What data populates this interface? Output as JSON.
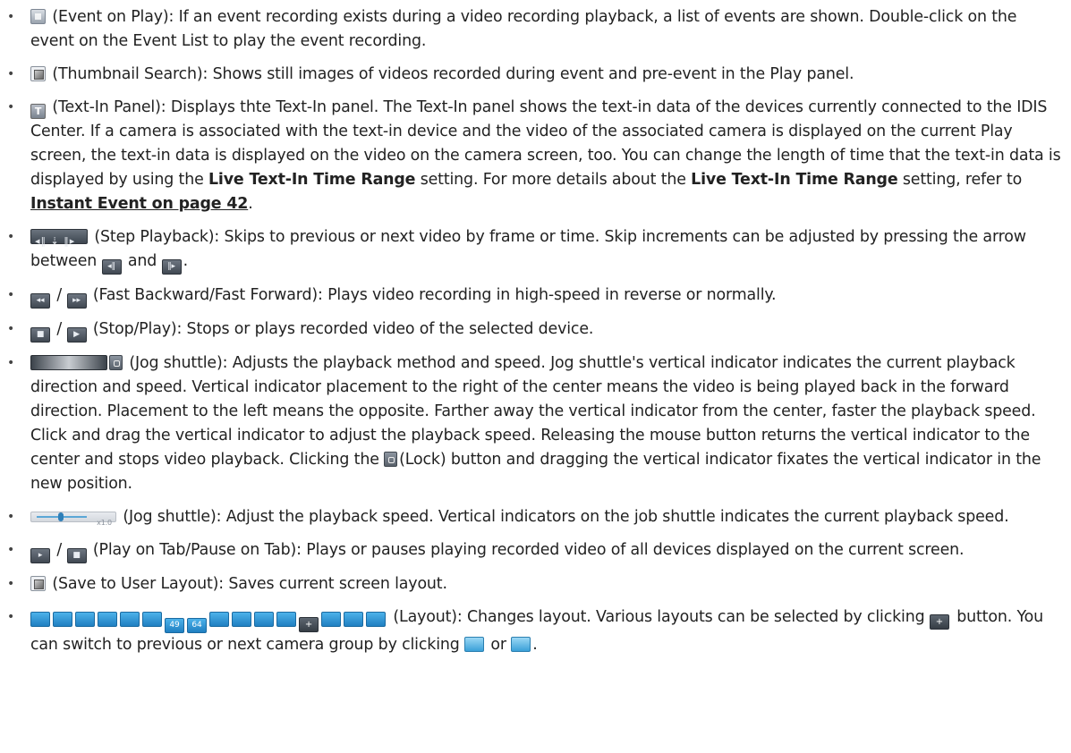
{
  "items": [
    {
      "icon_name": "event-on-play-icon",
      "text": "(Event on Play): If an event recording exists during a video recording playback, a list of events are shown. Double-click on the event on the Event List to play the event recording."
    },
    {
      "icon_name": "thumbnail-search-icon",
      "text": "(Thumbnail Search): Shows still images of videos recorded during event and pre-event in the Play panel."
    },
    {
      "icon_name": "text-in-panel-icon",
      "text_a": "(Text-In Panel): Displays thte Text-In panel. The Text-In panel shows the text-in data of the devices currently connected to the IDIS Center. If a camera is associated with the text-in device and the video of the associated camera is displayed on the current Play screen, the text-in data is displayed on the video on the camera screen, too. You can change the length of time that the text-in data is displayed by using the ",
      "bold_a": "Live Text-In Time Range",
      "text_b": " setting. For more details about the ",
      "bold_b": "Live Text-In Time Range",
      "text_c": " setting, refer to ",
      "link": "Instant Event on page 42",
      "text_d": "."
    },
    {
      "icon_name": "step-playback-icon",
      "text_a": "(Step Playback): Skips to previous or next video by frame or time. Skip increments can be adjusted by pressing the arrow between ",
      "text_b": " and ",
      "text_c": "."
    },
    {
      "icon_name": "fast-backward-forward-icon",
      "sep": "/",
      "text": "(Fast Backward/Fast Forward): Plays video recording in high-speed in reverse or normally."
    },
    {
      "icon_name": "stop-play-icon",
      "sep": "/",
      "text": "(Stop/Play): Stops or plays recorded video of the selected device."
    },
    {
      "icon_name": "jog-shuttle-icon",
      "text_a": "(Jog shuttle): Adjusts the playback method and speed. Jog shuttle's vertical indicator indicates the current playback direction and speed. Vertical indicator placement to the right of the center means the video is being played back in the forward direction. Placement to the left means the opposite. Farther away the vertical indicator from the center, faster the playback speed. Click and drag the vertical indicator to adjust the playback speed. Releasing the mouse button returns the vertical indicator to the center and stops video playback. Clicking the ",
      "text_b": "(Lock) button and dragging the vertical indicator fixates the vertical indicator in the new position."
    },
    {
      "icon_name": "jog-shuttle-slider-icon",
      "slider_label": "x1.0",
      "text": "(Jog shuttle): Adjust the playback speed. Vertical indicators on the job shuttle indicates the current playback speed."
    },
    {
      "icon_name": "play-pause-on-tab-icon",
      "sep": "/",
      "text": "(Play on Tab/Pause on Tab): Plays or pauses playing recorded video of all devices displayed on the current screen."
    },
    {
      "icon_name": "save-to-user-layout-icon",
      "text": "(Save to User Layout): Saves current screen layout."
    },
    {
      "icon_name": "layout-icons",
      "layout_numbers": [
        "49",
        "64"
      ],
      "text_a": "(Layout): Changes layout. Various layouts can be selected by clicking ",
      "text_b": " button. You can switch to previous or next camera group by clicking ",
      "text_c": " or ",
      "text_d": "."
    }
  ],
  "bullet": "•"
}
